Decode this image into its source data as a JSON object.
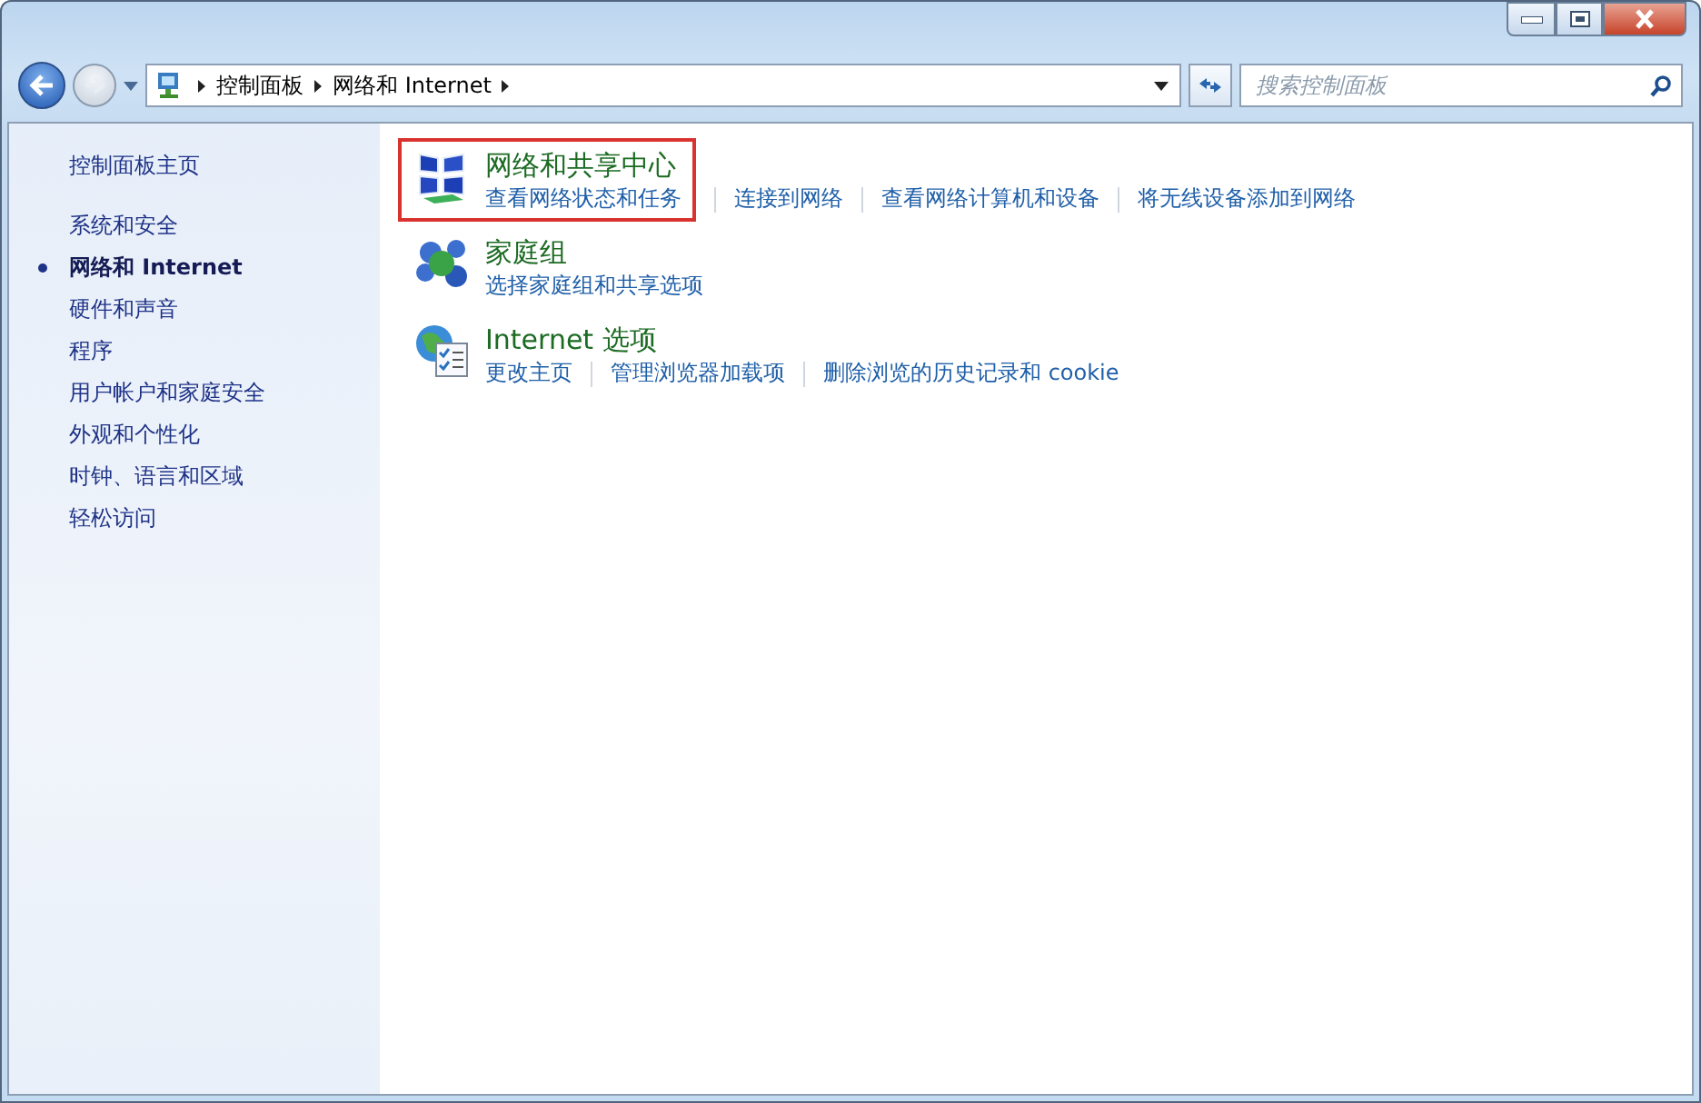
{
  "breadcrumb": [
    "控制面板",
    "网络和 Internet"
  ],
  "search": {
    "placeholder": "搜索控制面板"
  },
  "sidebar": {
    "home": "控制面板主页",
    "items": [
      {
        "label": "系统和安全",
        "selected": false
      },
      {
        "label": "网络和 Internet",
        "selected": true
      },
      {
        "label": "硬件和声音",
        "selected": false
      },
      {
        "label": "程序",
        "selected": false
      },
      {
        "label": "用户帐户和家庭安全",
        "selected": false
      },
      {
        "label": "外观和个性化",
        "selected": false
      },
      {
        "label": "时钟、语言和区域",
        "selected": false
      },
      {
        "label": "轻松访问",
        "selected": false
      }
    ]
  },
  "categories": [
    {
      "kind": "network",
      "title": "网络和共享中心",
      "highlighted": true,
      "links": [
        "查看网络状态和任务",
        "连接到网络",
        "查看网络计算机和设备",
        "将无线设备添加到网络"
      ]
    },
    {
      "kind": "homegroup",
      "title": "家庭组",
      "highlighted": false,
      "links": [
        "选择家庭组和共享选项"
      ]
    },
    {
      "kind": "internet",
      "title": "Internet 选项",
      "highlighted": false,
      "links": [
        "更改主页",
        "管理浏览器加载项",
        "删除浏览的历史记录和 cookie"
      ]
    }
  ]
}
